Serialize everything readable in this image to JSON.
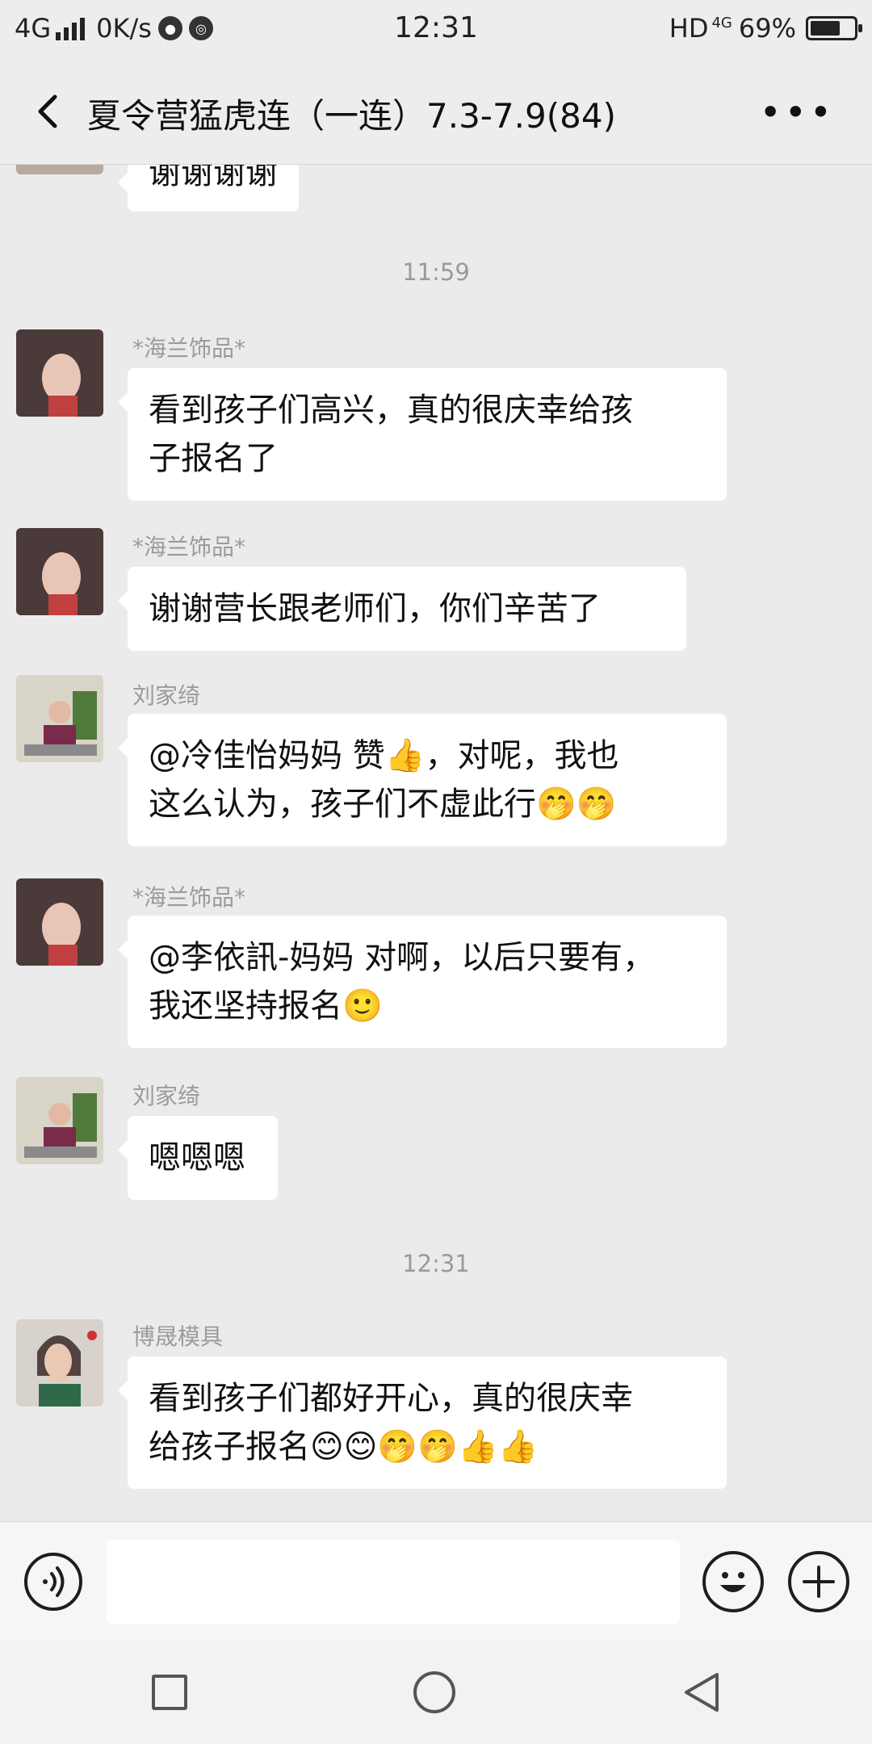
{
  "status_bar": {
    "network": "4G",
    "speed": "0K/s",
    "time": "12:31",
    "hd": "HD",
    "hd_net": "4G",
    "battery": "69%",
    "battery_level": 0.69
  },
  "header": {
    "title": "夏令营猛虎连（一连）7.3-7.9(84)",
    "more_label": "•••"
  },
  "chat": {
    "top_partial_message": "谢谢谢谢",
    "timestamps": [
      "11:59",
      "12:31"
    ],
    "messages": [
      {
        "sender": "*海兰饰品*",
        "line1": "看到孩子们高兴，真的很庆幸给孩",
        "line2": "子报名了"
      },
      {
        "sender": "*海兰饰品*",
        "line1": "谢谢营长跟老师们，你们辛苦了"
      },
      {
        "sender": "刘家绮",
        "line1": "@冷佳怡妈妈  赞👍，对呢，我也",
        "line2": "这么认为，孩子们不虚此行🤭🤭"
      },
      {
        "sender": "*海兰饰品*",
        "line1": "@李依訊-妈妈  对啊，以后只要有，",
        "line2": "我还坚持报名🙂"
      },
      {
        "sender": "刘家绮",
        "line1": "嗯嗯嗯"
      },
      {
        "sender": "博晟模具",
        "line1": "看到孩子们都好开心，真的很庆幸",
        "line2": "给孩子报名😊😊🤭🤭👍👍"
      }
    ]
  },
  "colors": {
    "chat_background": "#ebebeb",
    "bubble": "#ffffff",
    "header": "#ededed"
  }
}
